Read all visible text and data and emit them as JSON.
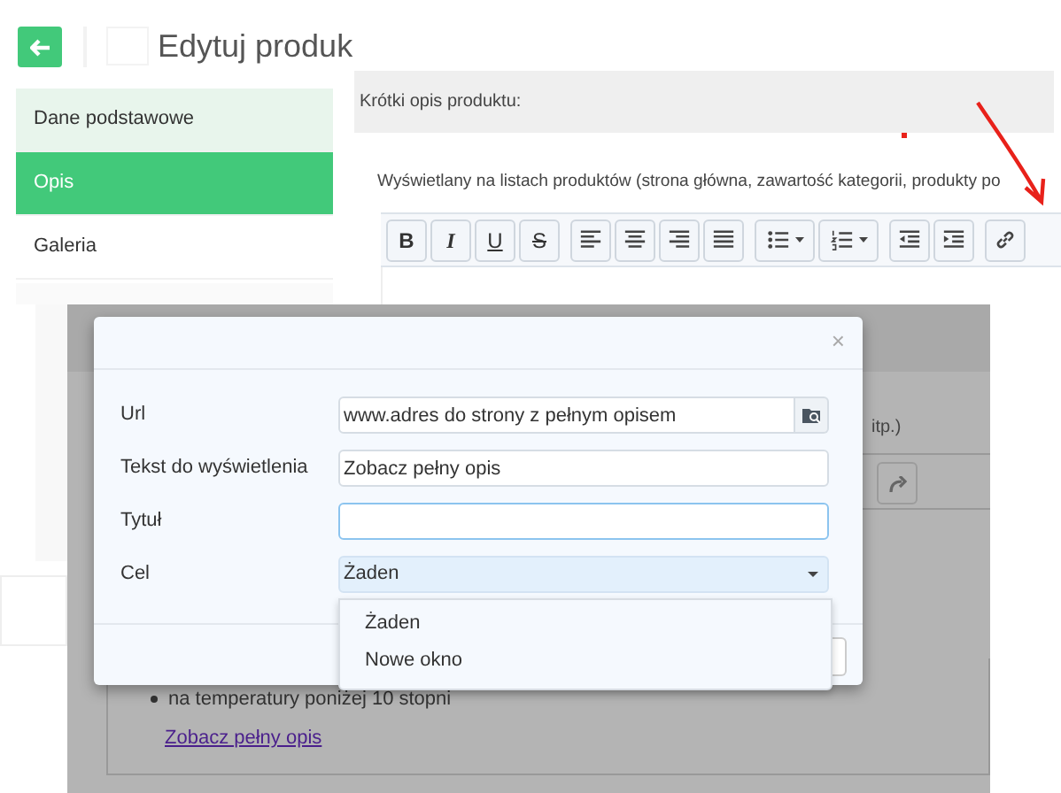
{
  "header": {
    "title": "Edytuj produk"
  },
  "sidebar": {
    "items": [
      {
        "label": "Dane podstawowe",
        "selected": false,
        "hovered": true
      },
      {
        "label": "Opis",
        "selected": true,
        "hovered": false
      },
      {
        "label": "Galeria",
        "selected": false,
        "hovered": false
      }
    ]
  },
  "editor": {
    "section_title": "Krótki opis produktu:",
    "hint": "Wyświetlany na listach produktów (strona główna, zawartość kategorii, produkty po",
    "toolbar": [
      {
        "buttons": [
          {
            "kind": "bold",
            "label": "B"
          },
          {
            "kind": "italic",
            "label": "I"
          },
          {
            "kind": "underline",
            "label": "U"
          },
          {
            "kind": "strike",
            "label": "S"
          }
        ]
      },
      {
        "buttons": [
          {
            "kind": "align-left"
          },
          {
            "kind": "align-center"
          },
          {
            "kind": "align-right"
          },
          {
            "kind": "justify"
          }
        ]
      },
      {
        "buttons": [
          {
            "kind": "bullets",
            "dropdown": true
          },
          {
            "kind": "numbers",
            "dropdown": true
          }
        ]
      },
      {
        "buttons": [
          {
            "kind": "outdent"
          },
          {
            "kind": "indent"
          }
        ]
      },
      {
        "buttons": [
          {
            "kind": "link"
          }
        ]
      }
    ]
  },
  "background_page": {
    "hint_tail": "itp.)",
    "bullet": "na temperatury poniżej 10 stopni",
    "link": "Zobacz pełny opis"
  },
  "dialog": {
    "close": "×",
    "fields": [
      {
        "kind": "text",
        "label": "Url",
        "value": "www.adres do strony z pełnym opisem",
        "browse": true
      },
      {
        "kind": "text",
        "label": "Tekst do wyświetlenia",
        "value": "Zobacz pełny opis"
      },
      {
        "kind": "text",
        "label": "Tytuł",
        "focused": true
      },
      {
        "kind": "select",
        "label": "Cel",
        "value": "Żaden",
        "open": true
      }
    ],
    "options": [
      {
        "label": "Żaden"
      },
      {
        "label": "Nowe okno"
      }
    ]
  }
}
